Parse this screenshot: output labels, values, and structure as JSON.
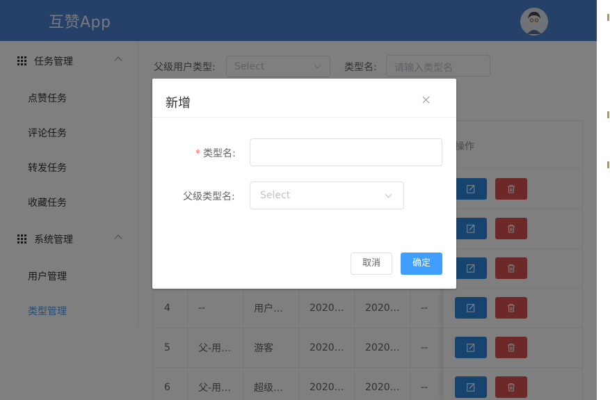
{
  "header": {
    "app_title": "互赞App"
  },
  "sidebar": {
    "groups": [
      {
        "label": "任务管理",
        "items": [
          "点赞任务",
          "评论任务",
          "转发任务",
          "收藏任务"
        ]
      },
      {
        "label": "系统管理",
        "items": [
          "用户管理",
          "类型管理"
        ]
      }
    ],
    "active_item": "类型管理"
  },
  "filters": {
    "parent_type_label": "父级用户类型:",
    "parent_type_placeholder": "Select",
    "type_name_label": "类型名:",
    "type_name_placeholder": "请输入类型名"
  },
  "table": {
    "op_header": "操作",
    "rows": [
      {
        "id": "4",
        "c2": "--",
        "c3": "用户…",
        "c4": "2020…",
        "c5": "2020…",
        "c6": "--"
      },
      {
        "id": "5",
        "c2": "父-用…",
        "c3": "游客",
        "c4": "2020…",
        "c5": "2020…",
        "c6": "--"
      },
      {
        "id": "6",
        "c2": "父-用…",
        "c3": "超级…",
        "c4": "2020…",
        "c5": "2020…",
        "c6": "--"
      }
    ]
  },
  "dialog": {
    "title": "新增",
    "required_mark": "*",
    "type_name_label": "类型名:",
    "parent_type_label": "父级类型名:",
    "parent_type_placeholder": "Select",
    "cancel_label": "取消",
    "confirm_label": "确定"
  },
  "colors": {
    "header_bg": "#4a82d5",
    "primary": "#409eff",
    "edit": "#2e86de",
    "delete": "#d9534f"
  }
}
